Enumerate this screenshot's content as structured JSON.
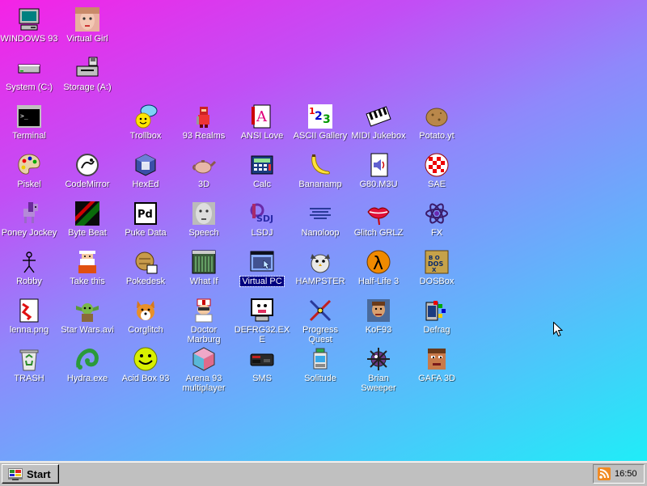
{
  "desktop": {
    "icons": [
      {
        "id": "windows93",
        "label": "WINDOWS 93",
        "icon": "computer-icon"
      },
      {
        "id": "virtualgirl",
        "label": "Virtual Girl",
        "icon": "virtual-girl-icon"
      },
      {
        "id": "systemc",
        "label": "System (C:)",
        "icon": "hard-drive-icon"
      },
      {
        "id": "storagea",
        "label": "Storage (A:)",
        "icon": "floppy-drive-icon"
      },
      {
        "id": "terminal",
        "label": "Terminal",
        "icon": "terminal-icon"
      },
      {
        "id": "trollbox",
        "label": "Trollbox",
        "icon": "chat-smiley-icon"
      },
      {
        "id": "realms",
        "label": "93 Realms",
        "icon": "knight-icon"
      },
      {
        "id": "ansilove",
        "label": "ANSI Love",
        "icon": "ansi-document-icon"
      },
      {
        "id": "ascii",
        "label": "ASCII Gallery",
        "icon": "ascii-123-icon"
      },
      {
        "id": "midi",
        "label": "MIDI Jukebox",
        "icon": "piano-keys-icon"
      },
      {
        "id": "potato",
        "label": "Potato.yt",
        "icon": "potato-icon"
      },
      {
        "id": "piskel",
        "label": "Piskel",
        "icon": "palette-icon"
      },
      {
        "id": "codemirror",
        "label": "CodeMirror",
        "icon": "codemirror-icon"
      },
      {
        "id": "hexed",
        "label": "HexEd",
        "icon": "cube-icon"
      },
      {
        "id": "threed",
        "label": "3D",
        "icon": "teapot-icon"
      },
      {
        "id": "calc",
        "label": "Calc",
        "icon": "calculator-icon"
      },
      {
        "id": "bananamp",
        "label": "Bananamp",
        "icon": "banana-icon"
      },
      {
        "id": "g80",
        "label": "G80.M3U",
        "icon": "speaker-file-icon"
      },
      {
        "id": "sae",
        "label": "SAE",
        "icon": "checkered-ball-icon"
      },
      {
        "id": "poney",
        "label": "Poney Jockey",
        "icon": "pony-icon"
      },
      {
        "id": "bytebeat",
        "label": "Byte Beat",
        "icon": "bytebeat-icon"
      },
      {
        "id": "pukedata",
        "label": "Puke Data",
        "icon": "pd-icon"
      },
      {
        "id": "speech",
        "label": "Speech",
        "icon": "face-speech-icon"
      },
      {
        "id": "lsdj",
        "label": "LSDJ",
        "icon": "lsdj-icon"
      },
      {
        "id": "nanoloop",
        "label": "Nanoloop",
        "icon": "waveform-icon"
      },
      {
        "id": "glitch",
        "label": "Glitch GRLZ",
        "icon": "lips-icon"
      },
      {
        "id": "fx",
        "label": "FX",
        "icon": "atom-icon"
      },
      {
        "id": "robby",
        "label": "Robby",
        "icon": "stick-figure-icon"
      },
      {
        "id": "takethis",
        "label": "Take this",
        "icon": "old-man-icon"
      },
      {
        "id": "pokedesk",
        "label": "Pokedesk",
        "icon": "pokedesk-icon"
      },
      {
        "id": "whatif",
        "label": "What If",
        "icon": "what-if-icon"
      },
      {
        "id": "virtualpc",
        "label": "Virtual PC",
        "icon": "virtual-pc-icon"
      },
      {
        "id": "hampster",
        "label": "HAMPSTER",
        "icon": "hamster-icon"
      },
      {
        "id": "halflife3",
        "label": "Half-Life 3",
        "icon": "lambda-icon"
      },
      {
        "id": "dosbox",
        "label": "DOSBox",
        "icon": "dosbox-icon"
      },
      {
        "id": "lenna",
        "label": "lenna.png",
        "icon": "image-file-icon"
      },
      {
        "id": "starwars",
        "label": "Star Wars.avi",
        "icon": "yoda-icon"
      },
      {
        "id": "corglitch",
        "label": "Corglitch",
        "icon": "corgi-icon"
      },
      {
        "id": "doctor",
        "label": "Doctor Marburg",
        "icon": "doctor-icon"
      },
      {
        "id": "defrag32",
        "label": "DEFRG32.EXE",
        "icon": "defrag-monitor-icon"
      },
      {
        "id": "progress",
        "label": "Progress Quest",
        "icon": "swords-icon"
      },
      {
        "id": "kof",
        "label": "KoF93",
        "icon": "fighter-icon"
      },
      {
        "id": "defrag",
        "label": "Defrag",
        "icon": "defrag-icon"
      },
      {
        "id": "trash",
        "label": "TRASH",
        "icon": "recycle-bin-icon"
      },
      {
        "id": "hydra",
        "label": "Hydra.exe",
        "icon": "hydra-icon"
      },
      {
        "id": "acidbox",
        "label": "Acid Box 93",
        "icon": "acid-smiley-icon"
      },
      {
        "id": "arena",
        "label": "Arena 93 multiplayer",
        "icon": "arena-cube-icon"
      },
      {
        "id": "sms",
        "label": "SMS",
        "icon": "console-icon"
      },
      {
        "id": "solitude",
        "label": "Solitude",
        "icon": "solitude-icon"
      },
      {
        "id": "brian",
        "label": "Brian Sweeper",
        "icon": "mine-icon"
      },
      {
        "id": "gafa",
        "label": "GAFA 3D",
        "icon": "doom-face-icon"
      }
    ],
    "selected": "virtualpc"
  },
  "taskbar": {
    "start_label": "Start",
    "clock": "16:50",
    "tray_icon": "rss-icon"
  },
  "colors": {
    "gradient_start": "#f522e6",
    "gradient_end": "#19f3f7",
    "taskbar": "#c0c0c0",
    "selection": "#000080"
  }
}
